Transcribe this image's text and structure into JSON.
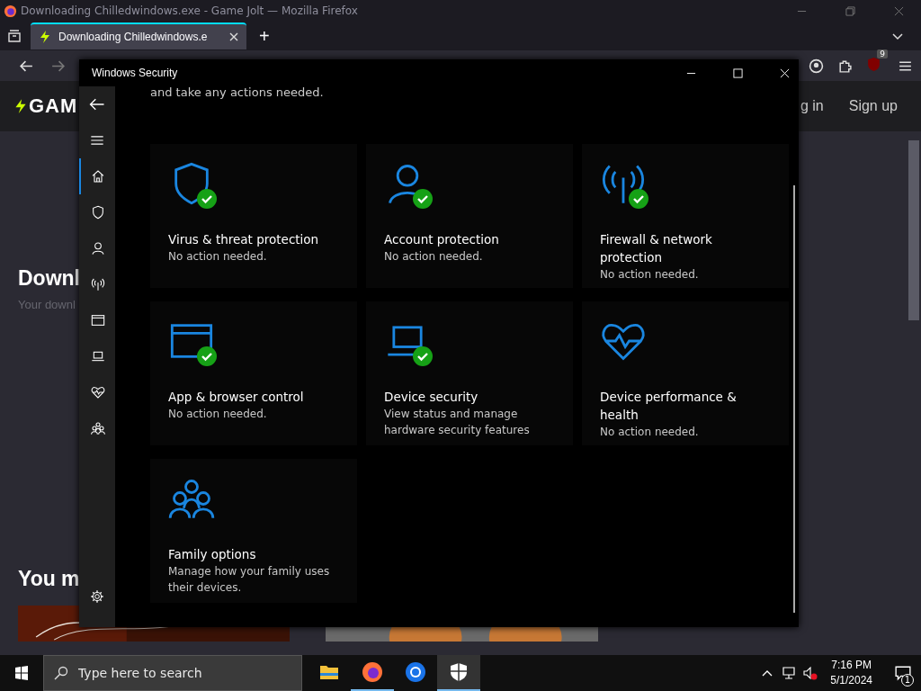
{
  "browser": {
    "title": "Downloading Chilledwindows.exe - Game Jolt — Mozilla Firefox",
    "tabs": [
      {
        "label": "Downloading Chilledwindows.e",
        "selected": true
      }
    ],
    "new_tab": "+",
    "extension_badge": "9"
  },
  "page": {
    "logo": "GAM",
    "login": "g in",
    "signup": "Sign up",
    "heading": "Downl",
    "subheading": "Your downl",
    "section": "You m"
  },
  "window": {
    "title": "Windows Security",
    "intro": "and take any actions needed.",
    "nav": [
      {
        "kind": "home",
        "selected": true
      },
      {
        "kind": "shield",
        "selected": false
      },
      {
        "kind": "person",
        "selected": false
      },
      {
        "kind": "antenna",
        "selected": false
      },
      {
        "kind": "browser",
        "selected": false
      },
      {
        "kind": "laptop",
        "selected": false
      },
      {
        "kind": "heart",
        "selected": false
      },
      {
        "kind": "family",
        "selected": false
      }
    ],
    "tiles": [
      {
        "kind": "shield",
        "title": "Virus & threat protection",
        "status": "No action needed.",
        "ok": true
      },
      {
        "kind": "person",
        "title": "Account protection",
        "status": "No action needed.",
        "ok": true
      },
      {
        "kind": "antenna",
        "title": "Firewall & network protection",
        "status": "No action needed.",
        "ok": true
      },
      {
        "kind": "browser",
        "title": "App & browser control",
        "status": "No action needed.",
        "ok": true
      },
      {
        "kind": "laptop",
        "title": "Device security",
        "status": "View status and manage hardware security features",
        "ok": true
      },
      {
        "kind": "heart",
        "title": "Device performance & health",
        "status": "No action needed.",
        "ok": false
      },
      {
        "kind": "family",
        "title": "Family options",
        "status": "Manage how your family uses their devices.",
        "ok": false
      }
    ]
  },
  "taskbar": {
    "search_placeholder": "Type here to search",
    "apps": [
      {
        "kind": "folder",
        "running": false,
        "selected": false
      },
      {
        "kind": "firefox",
        "running": true,
        "selected": false
      },
      {
        "kind": "chrome",
        "running": false,
        "selected": false
      },
      {
        "kind": "security",
        "running": true,
        "selected": true
      }
    ],
    "time": "7:16 PM",
    "date": "5/1/2024",
    "notifications": "1"
  }
}
